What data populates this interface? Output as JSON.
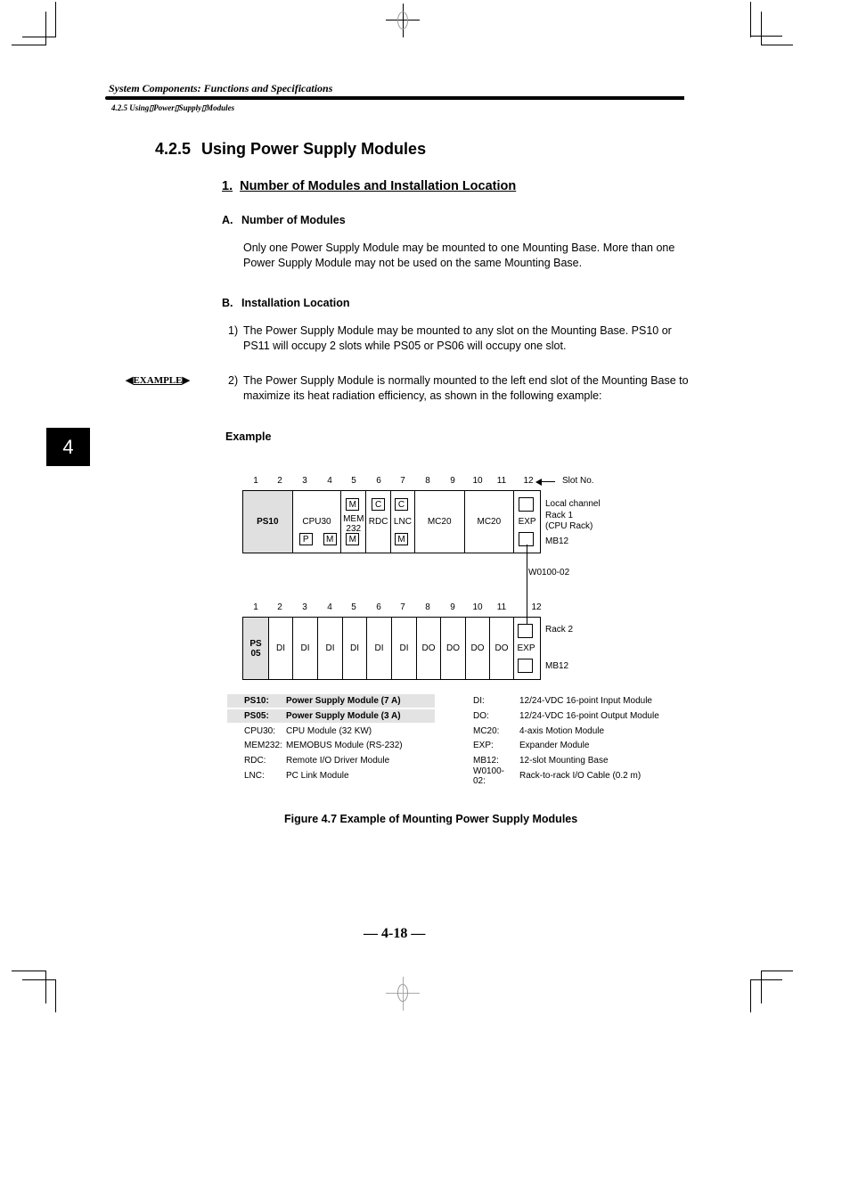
{
  "header": {
    "title": "System Components: Functions and Specifications",
    "breadcrumb": "4.2.5 Using▯Power▯Supply▯Modules"
  },
  "chapter_tab": "4",
  "section": {
    "number": "4.2.5",
    "title": "Using Power Supply Modules"
  },
  "subsection": {
    "number": "1.",
    "title": "Number of Modules and Installation Location"
  },
  "items": [
    {
      "letter": "A.",
      "title": "Number of Modules",
      "text": "Only one Power Supply Module may be mounted to one Mounting Base. More than one Power Supply Module may not be used on the same Mounting Base."
    },
    {
      "letter": "B.",
      "title": "Installation Location",
      "points": [
        {
          "n": "1)",
          "text": "The Power Supply Module may be mounted to any slot on the Mounting Base. PS10 or PS11 will occupy 2 slots while PS05 or PS06 will occupy one slot."
        },
        {
          "n": "2)",
          "text": "The Power Supply Module is normally mounted to the left end slot of the Mounting Base to maximize its heat radiation efficiency, as shown in the following example:"
        }
      ]
    }
  ],
  "example_tag": "EXAMPLE",
  "example_label": "Example",
  "figure": {
    "slot_label": "Slot No.",
    "slot_numbers": [
      "1",
      "2",
      "3",
      "4",
      "5",
      "6",
      "7",
      "8",
      "9",
      "10",
      "11",
      "12"
    ],
    "rack1": {
      "modules": {
        "ps10": "PS10",
        "cpu30": "CPU30",
        "mem_line1": "MEM",
        "mem_line2": "232",
        "rdc": "RDC",
        "lnc": "LNC",
        "mc20a": "MC20",
        "mc20b": "MC20",
        "exp": "EXP"
      },
      "ports": {
        "p": "P",
        "m": "M",
        "c": "C"
      },
      "side_label": [
        "Local channel",
        "Rack 1",
        "(CPU Rack)"
      ],
      "base_label": "MB12"
    },
    "cable_label": "W0100-02",
    "rack2": {
      "ps_line1": "PS",
      "ps_line2": "05",
      "modules": [
        "DI",
        "DI",
        "DI",
        "DI",
        "DI",
        "DI",
        "DO",
        "DO",
        "DO",
        "DO"
      ],
      "exp": "EXP",
      "side_label": "Rack 2",
      "base_label": "MB12"
    },
    "legend_left": [
      {
        "key": "PS10:",
        "value": "Power Supply Module (7 A)",
        "highlight": true
      },
      {
        "key": "PS05:",
        "value": "Power Supply Module (3 A)",
        "highlight": true
      },
      {
        "key": "CPU30:",
        "value": "CPU Module (32 KW)"
      },
      {
        "key": "MEM232:",
        "value": "MEMOBUS Module (RS-232)"
      },
      {
        "key": "RDC:",
        "value": "Remote I/O Driver Module"
      },
      {
        "key": "LNC:",
        "value": "PC Link Module"
      }
    ],
    "legend_right": [
      {
        "key": "DI:",
        "value": "12/24-VDC 16-point Input Module"
      },
      {
        "key": "DO:",
        "value": "12/24-VDC 16-point Output Module"
      },
      {
        "key": "MC20:",
        "value": "4-axis Motion Module"
      },
      {
        "key": "EXP:",
        "value": "Expander Module"
      },
      {
        "key": "MB12:",
        "value": "12-slot Mounting Base"
      },
      {
        "key": "W0100-02:",
        "value": "Rack-to-rack I/O Cable (0.2 m)"
      }
    ],
    "caption": "Figure 4.7 Example of Mounting Power Supply Modules"
  },
  "page_number": "— 4-18 —"
}
